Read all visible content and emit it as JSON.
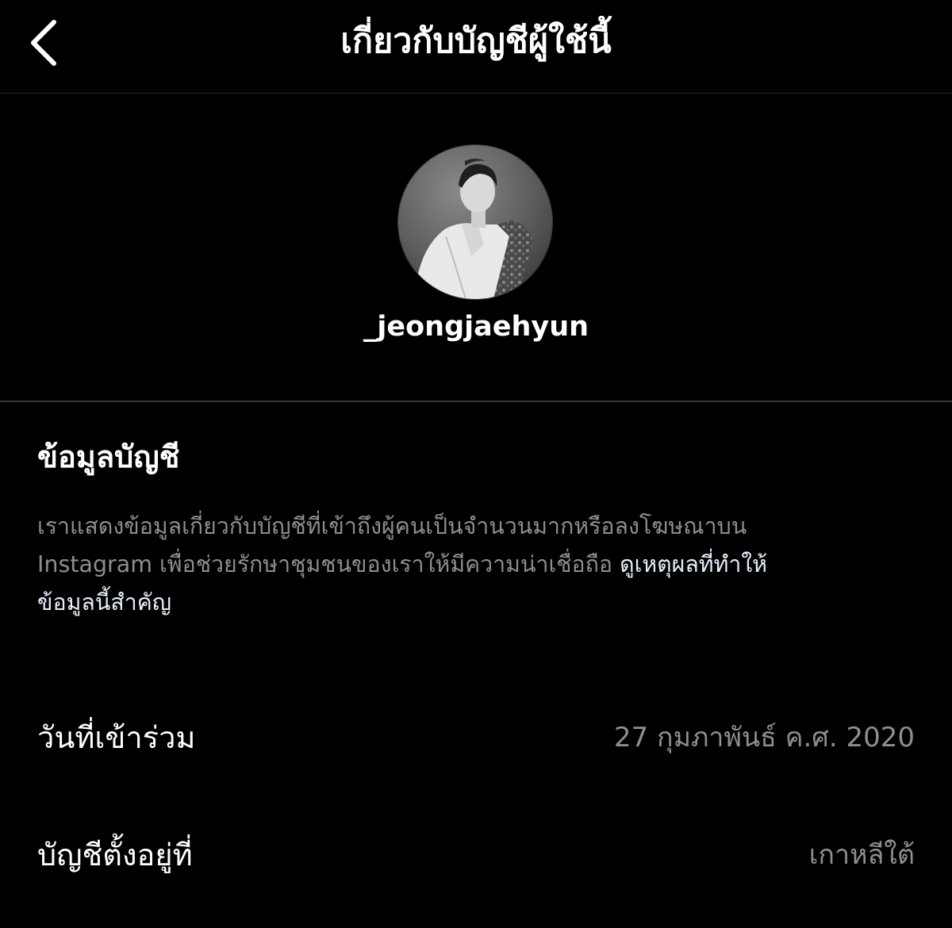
{
  "header": {
    "title": "เกี่ยวกับบัญชีผู้ใช้นี้",
    "back_icon": "chevron-left-icon"
  },
  "profile": {
    "username": "_jeongjaehyun",
    "avatar": "profile-photo"
  },
  "account_info": {
    "title": "ข้อมูลบัญชี",
    "description_line1": "เราแสดงข้อมูลเกี่ยวกับบัญชีที่เข้าถึงผู้คนเป็นจำนวนมากหรือลงโฆษณาบน",
    "description_line2": "Instagram เพื่อช่วยรักษาชุมชนของเราให้มีความน่าเชื่อถือ",
    "link_line2": "ดูเหตุผลที่ทำให้",
    "link_line3": "ข้อมูลนี้สำคัญ"
  },
  "rows": [
    {
      "label": "วันที่เข้าร่วม",
      "value": "27 กุมภาพันธ์ ค.ศ. 2020"
    },
    {
      "label": "บัญชีตั้งอยู่ที่",
      "value": "เกาหลีใต้"
    }
  ],
  "colors": {
    "background": "#000000",
    "primary_text": "#ffffff",
    "secondary_text": "#8e8e8e",
    "divider": "#363636"
  }
}
